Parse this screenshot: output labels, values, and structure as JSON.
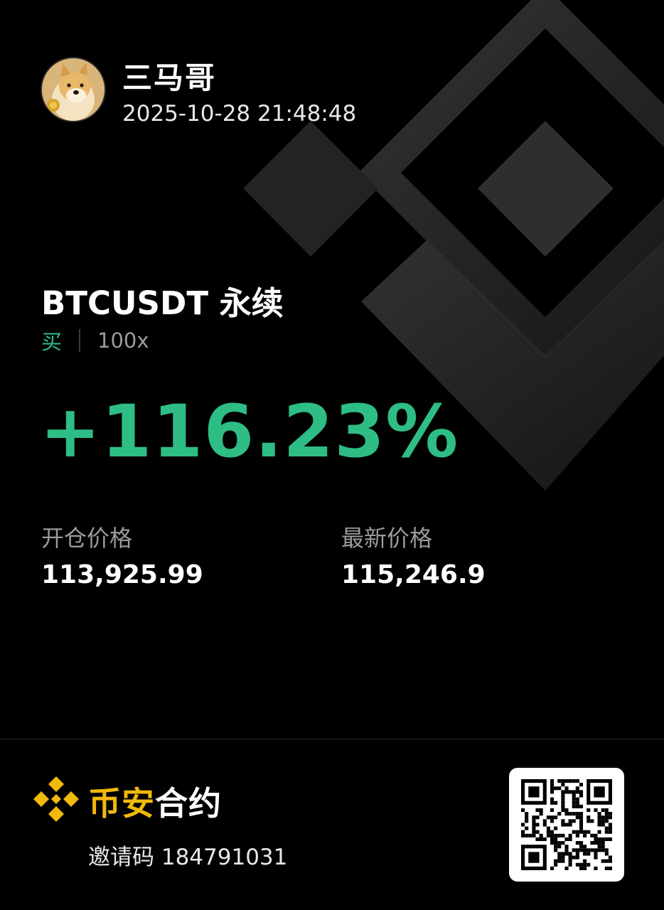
{
  "user": {
    "name": "三马哥",
    "timestamp": "2025-10-28 21:48:48"
  },
  "position": {
    "pair": "BTCUSDT 永续",
    "side": "买",
    "leverage": "100x",
    "pnl": "+116.23%"
  },
  "prices": {
    "entry_label": "开仓价格",
    "entry_value": "113,925.99",
    "latest_label": "最新价格",
    "latest_value": "115,246.9"
  },
  "footer": {
    "brand_part1": "币安",
    "brand_part2": "合约",
    "invite_text": "邀请码 184791031"
  },
  "icons": {
    "avatar": "doge-avatar",
    "background": "binance-logo-icon",
    "footer_logo": "binance-logo-icon",
    "qr": "qr-code-icon"
  },
  "colors": {
    "profit_green": "#2ebd85",
    "brand_yellow": "#f0b90b",
    "background": "#000000"
  }
}
